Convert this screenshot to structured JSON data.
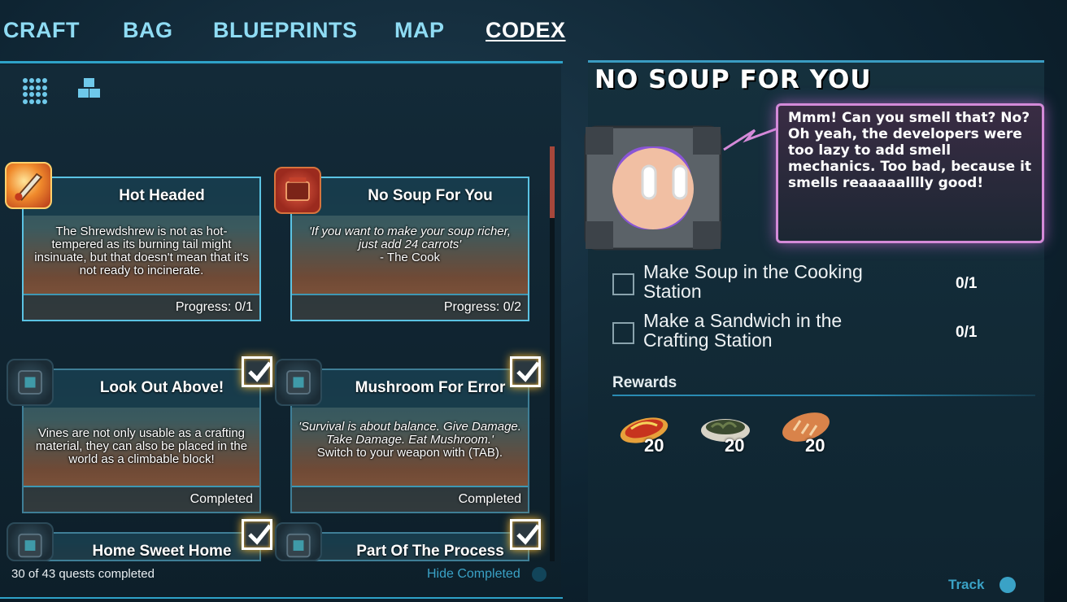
{
  "nav": {
    "tabs": [
      {
        "label": "CRAFT",
        "active": false
      },
      {
        "label": "BAG",
        "active": false
      },
      {
        "label": "BLUEPRINTS",
        "active": false
      },
      {
        "label": "MAP",
        "active": false
      },
      {
        "label": "CODEX",
        "active": true
      }
    ]
  },
  "view_icons": [
    "grid-view-icon",
    "blocks-view-icon"
  ],
  "quests": [
    {
      "title": "Hot Headed",
      "description": "The Shrewdshrew is not as hot-tempered as its burning tail might insinuate, but that doesn't mean that it's not ready to incinerate.",
      "italic": "",
      "status": "Progress: 0/1",
      "completed": false,
      "icon": "flaming-sword-icon"
    },
    {
      "title": "No Soup For You",
      "description": "",
      "italic": "'If you want to make your soup richer, just add 24 carrots'",
      "attribution": "- The Cook",
      "status": "Progress: 0/2",
      "completed": false,
      "icon": "cooking-pot-icon"
    },
    {
      "title": "Look Out Above!",
      "description": "Vines are not only usable as a crafting material, they can also be placed in the world as a climbable block!",
      "italic": "",
      "status": "Completed",
      "completed": true,
      "icon": "npc-cube-icon"
    },
    {
      "title": "Mushroom For Error",
      "description": "Switch to your weapon with (TAB).",
      "italic": "'Survival is about balance. Give Damage. Take Damage. Eat Mushroom.'",
      "status": "Completed",
      "completed": true,
      "icon": "npc-cube-icon"
    },
    {
      "title": "Home Sweet Home",
      "description": "",
      "italic": "",
      "status": "",
      "completed": true,
      "icon": "npc-cube-icon"
    },
    {
      "title": "Part Of The Process",
      "description": "",
      "italic": "",
      "status": "",
      "completed": true,
      "icon": "npc-cube-icon"
    }
  ],
  "footer": {
    "quest_count": "30 of 43 quests completed",
    "hide_completed": "Hide Completed"
  },
  "detail": {
    "heading": "NO SOUP FOR YOU",
    "speech": "Mmm! Can you smell that? No? Oh yeah, the developers were too lazy to add smell mechanics. Too bad, because it smells reaaaaalllly good!",
    "objectives": [
      {
        "text": "Make Soup in the Cooking Station",
        "count": "0/1"
      },
      {
        "text": "Make a Sandwich in the Crafting Station",
        "count": "0/1"
      }
    ],
    "rewards_label": "Rewards",
    "rewards": [
      {
        "icon": "pizza-slice-icon",
        "qty": "20"
      },
      {
        "icon": "seaweed-bowl-icon",
        "qty": "20"
      },
      {
        "icon": "bread-loaf-icon",
        "qty": "20"
      }
    ],
    "track_label": "Track"
  },
  "colors": {
    "accent": "#2ea2c8",
    "nav_inactive": "#8fdcf4",
    "speech_border": "#d48ad9",
    "completed_glow": "#f3b533"
  }
}
